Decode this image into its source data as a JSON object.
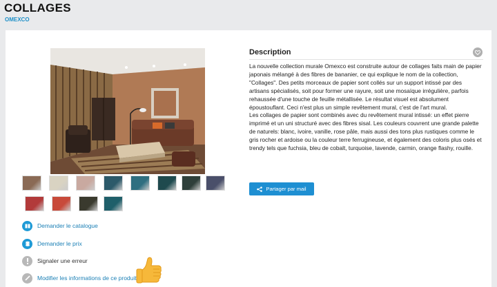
{
  "header": {
    "title": "COLLAGES",
    "brand": "OMEXCO"
  },
  "gallery": {
    "main_image_icon": "living-room-photo",
    "thumbnails": [
      {
        "name": "thumb-1",
        "color": "#8a6a55"
      },
      {
        "name": "thumb-2",
        "color": "#d9d3c2"
      },
      {
        "name": "thumb-3",
        "color": "#c9a9a0"
      },
      {
        "name": "thumb-4",
        "color": "#2c5a6a"
      },
      {
        "name": "thumb-5",
        "color": "#2f6f80"
      },
      {
        "name": "thumb-6",
        "color": "#1f4a4e"
      },
      {
        "name": "thumb-7",
        "color": "#2f3f3a"
      },
      {
        "name": "thumb-8",
        "color": "#4a4f6a"
      },
      {
        "name": "thumb-9",
        "color": "#b23a3a"
      },
      {
        "name": "thumb-10",
        "color": "#c84a3a"
      },
      {
        "name": "thumb-11",
        "color": "#3a3a2e"
      },
      {
        "name": "thumb-12",
        "color": "#1f5f6a"
      }
    ]
  },
  "actions": {
    "catalogue": "Demander le catalogue",
    "price": "Demander le prix",
    "report": "Signaler une erreur",
    "edit": "Modifier les informations de ce produit"
  },
  "description": {
    "title": "Description",
    "paragraph_1": "La nouvelle collection murale Omexco est construite autour de collages faits main de papier japonais mélangé à des fibres de bananier, ce qui explique le nom de la collection, \"Collages\". Des petits morceaux de papier sont collés sur un support intissé par des artisans spécialisés, soit pour former une rayure, soit une mosaïque irrégulière, parfois rehaussée d'une touche de feuille métallisée. Le résultat visuel est absolument époustouflant. Ceci n'est plus un simple revêtement mural, c'est de l'art mural.",
    "paragraph_2": "Les collages de papier sont combinés avec du revêtement mural intissé: un effet pierre imprimé et un uni structuré avec des fibres sisal. Les couleurs couvrent une grande palette de naturels: blanc, ivoire, vanille, rose pâle, mais aussi des tons plus rustiques comme le gris rocher et ardoise ou la couleur terre ferrugineuse, et également des coloris plus osés et trendy tels que fuchsia, bleu de cobalt, turquoise, lavende, carmin, orange flashy, rouille."
  },
  "share": {
    "label": "Partager par mail",
    "icon": "share-icon"
  },
  "favorite": {
    "icon": "heart-icon"
  },
  "colors": {
    "accent": "#1e8fd2",
    "link": "#1a7fb5",
    "background": "#e9eaec"
  }
}
